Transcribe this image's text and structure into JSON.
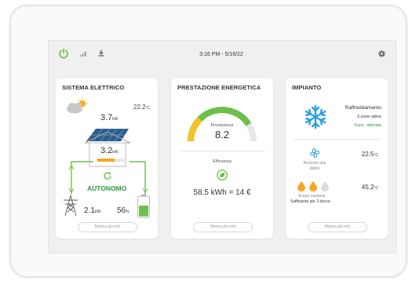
{
  "topbar": {
    "time": "3:16 PM - 5/16/22",
    "icons": [
      "power-icon",
      "signal-icon",
      "download-icon",
      "gear-icon"
    ]
  },
  "colors": {
    "accent_green": "#6cc04a",
    "dark_green": "#2e9b3a",
    "blue": "#2c9fe0"
  },
  "sistema": {
    "title": "SISTEMA ELETTRICO",
    "temperature": "22.2",
    "temp_unit": "°C",
    "solar_value": "3.7",
    "solar_unit": "kW",
    "house_value": "3.2",
    "house_unit": "kW",
    "status": "AUTONOMO",
    "grid_value": "2.1",
    "grid_unit": "kW",
    "battery_value": "56",
    "battery_unit": "%",
    "more_label": "Mostra più info"
  },
  "prestazione": {
    "title": "PRESTAZIONE ENERGETICA",
    "gauge_label": "Prestazione",
    "gauge_value": "8.2",
    "gauge_fraction": 0.82,
    "efficiency_label": "Efficienza",
    "energy_text": "58.5 kWh = 14 €",
    "more_label": "Mostra più info"
  },
  "impianto": {
    "title": "IMPIANTO",
    "mode": "Raffreddamento",
    "zones": "3 zone attive",
    "function_status": "Funz. ottimale",
    "air_label": "Ricircolo aria",
    "air_status": "Attivo",
    "air_temp": "22.5",
    "water_label": "Acqua sanitaria",
    "water_status": "Sufficiente per 2 docce",
    "water_temp": "45.2",
    "temp_unit": "°C",
    "more_label": "Mostra più info"
  }
}
